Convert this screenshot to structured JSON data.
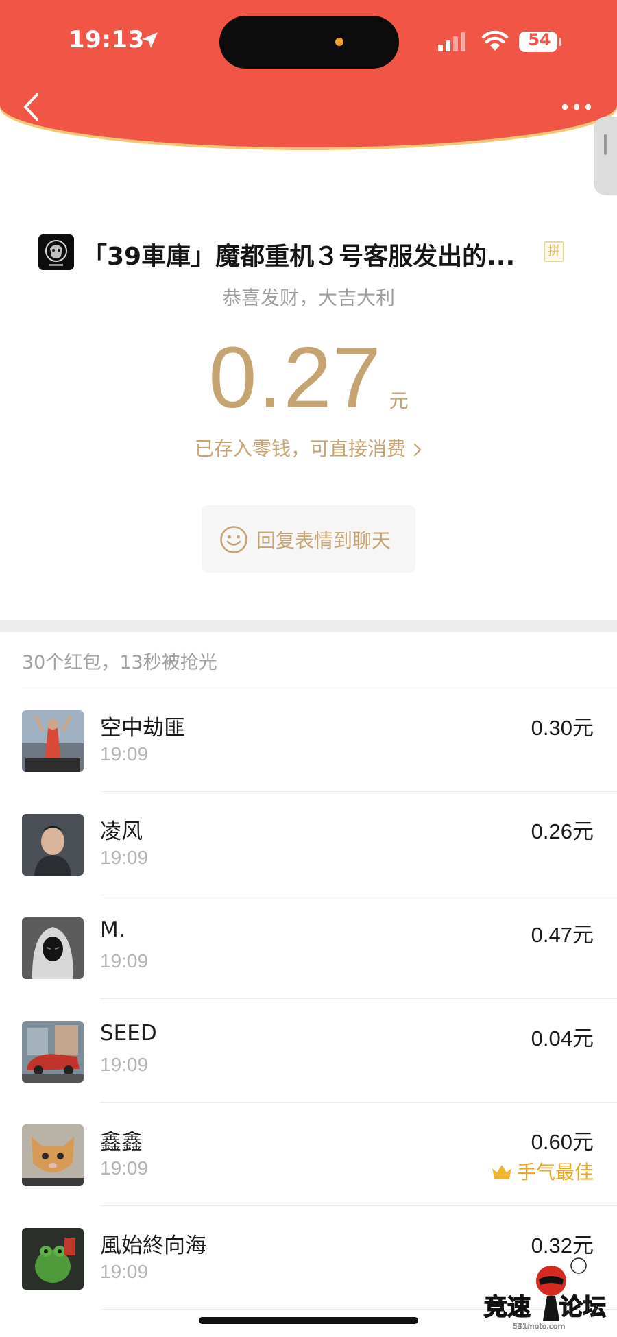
{
  "status_bar": {
    "time": "19:13",
    "battery": "54"
  },
  "colors": {
    "header_red": "#f05545",
    "gold": "#c6a472",
    "best_badge": "#e8a726"
  },
  "header": {
    "back_icon": "chevron-left-icon",
    "more_icon": "more-dots-icon",
    "sender_title": "「39車庫」魔都重机３号客服发出的...",
    "pin_badge": "拼"
  },
  "packet": {
    "greeting": "恭喜发财，大吉大利",
    "amount": "0.27",
    "unit": "元",
    "saved_note": "已存入零钱，可直接消费",
    "reply_button": "回复表情到聊天"
  },
  "summary": "30个红包，13秒被抢光",
  "receivers": [
    {
      "name": "空中劫匪",
      "time": "19:09",
      "amount": "0.30元"
    },
    {
      "name": "凌风",
      "time": "19:09",
      "amount": "0.26元"
    },
    {
      "name": "M.",
      "time": "19:09",
      "amount": "0.47元"
    },
    {
      "name": "SEED",
      "time": "19:09",
      "amount": "0.04元"
    },
    {
      "name": "鑫鑫",
      "time": "19:09",
      "amount": "0.60元",
      "badge": "手气最佳"
    },
    {
      "name": "風始終向海",
      "time": "19:09",
      "amount": "0.32元"
    }
  ],
  "watermark": {
    "logo_text": "竞速论坛",
    "site": "591moto.com"
  }
}
